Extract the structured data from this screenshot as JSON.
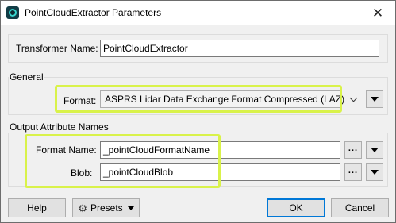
{
  "window": {
    "title": "PointCloudExtractor Parameters",
    "close_glyph": "✕"
  },
  "transformer": {
    "label": "Transformer Name:",
    "value": "PointCloudExtractor"
  },
  "general": {
    "group_title": "General",
    "format_label": "Format:",
    "format_value": "ASPRS Lidar Data Exchange Format Compressed (LAZ)"
  },
  "output": {
    "group_title": "Output Attribute Names",
    "format_name_label": "Format Name:",
    "format_name_value": "_pointCloudFormatName",
    "blob_label": "Blob:",
    "blob_value": "_pointCloudBlob",
    "ellipsis": "..."
  },
  "buttons": {
    "help": "Help",
    "presets": "Presets",
    "ok": "OK",
    "cancel": "Cancel"
  },
  "icons": {
    "app": "point-cloud-app-icon",
    "presets": "gear-icon",
    "menu": "triangle-down-icon",
    "combo": "chevron-down-icon"
  },
  "colors": {
    "highlight": "#d9f24a",
    "default_button_border": "#0078d7",
    "app_icon": "#38d6cf"
  }
}
